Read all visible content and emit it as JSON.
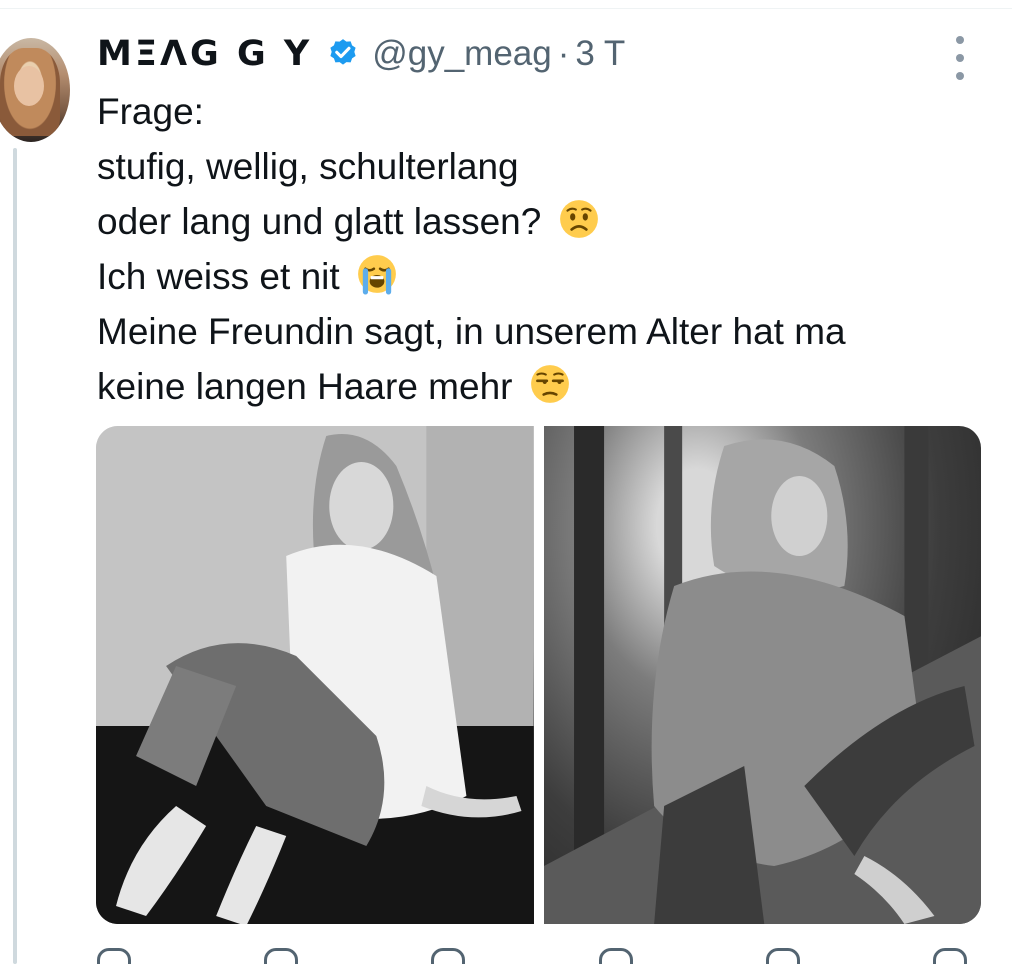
{
  "tweet": {
    "display_name": "MΞΛG G Y",
    "handle": "@gy_meag",
    "separator": "·",
    "time": "3 T",
    "text_lines": [
      "Frage:",
      "stufig, wellig, schulterlang",
      "oder lang und glatt lassen?",
      "Ich weiss et nit",
      "Meine Freundin sagt, in unserem Alter hat ma",
      "keine langen Haare mehr"
    ],
    "emojis": [
      "worried-face-emoji",
      "loudly-crying-face-emoji",
      "unamused-face-emoji"
    ],
    "verified_color": "#1d9bf0",
    "media": [
      {
        "name": "photo-woman-white-shirt-jeans",
        "style": "black-and-white"
      },
      {
        "name": "photo-woman-knit-sweater-forest",
        "style": "black-and-white"
      }
    ]
  },
  "actions": [
    "reply-icon",
    "repost-icon",
    "like-icon",
    "views-icon",
    "bookmark-icon",
    "share-icon"
  ]
}
